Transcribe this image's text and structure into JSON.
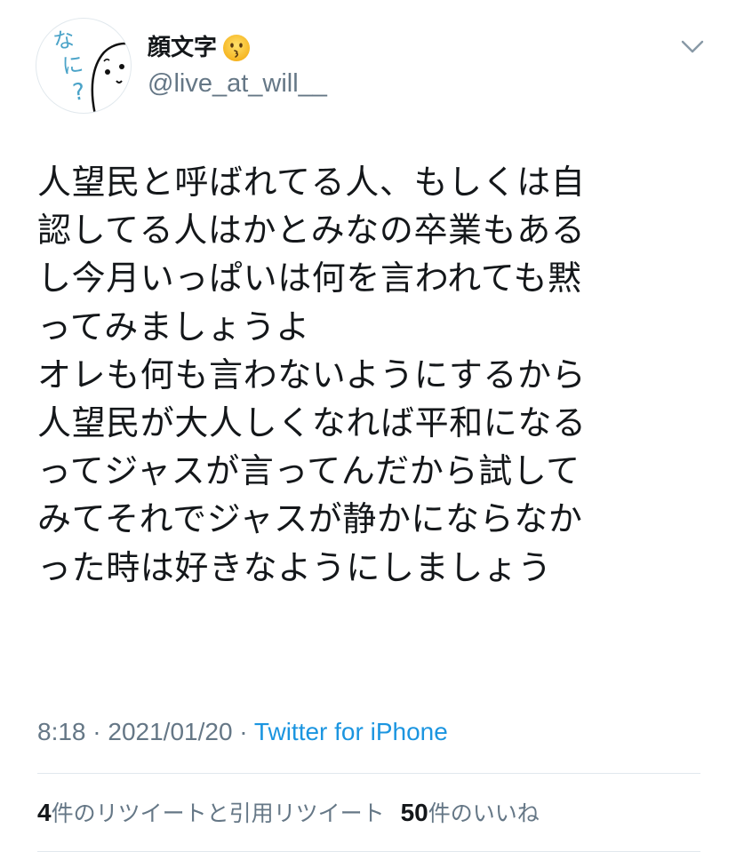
{
  "user": {
    "display_name": "顔文字",
    "handle": "@live_at_will__",
    "emoji_icon": "kissing-face-emoji",
    "avatar_icon": "nani-question-character-avatar",
    "avatar_text": "なに?"
  },
  "menu": {
    "caret_icon": "chevron-down-icon"
  },
  "tweet": {
    "lines": [
      "人望民と呼ばれてる人、もしくは自",
      "認してる人はかとみなの卒業もある",
      "し今月いっぱいは何を言われても黙",
      "ってみましょうよ",
      "オレも何も言わないようにするから",
      "人望民が大人しくなれば平和になる",
      "ってジャスが言ってんだから試して",
      "みてそれでジャスが静かにならなか",
      "った時は好きなようにしましょう"
    ]
  },
  "meta": {
    "time": "8:18",
    "separator": " · ",
    "date": "2021/01/20",
    "source": "Twitter for iPhone"
  },
  "stats": {
    "retweets_count": "4",
    "retweets_label": "件のリツイートと引用リツイート",
    "likes_count": "50",
    "likes_label": "件のいいね"
  },
  "colors": {
    "text": "#14171a",
    "secondary": "#657786",
    "link": "#1b95e0",
    "divider": "#e1e8ed",
    "avatar_text": "#4aa3c8"
  }
}
